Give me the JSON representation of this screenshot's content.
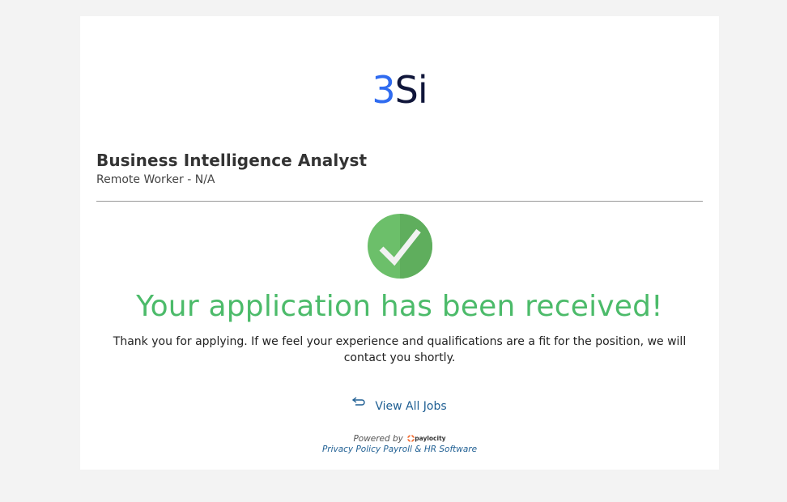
{
  "logo": {
    "part1": "3",
    "part2": "Si"
  },
  "job": {
    "title": "Business Intelligence Analyst",
    "location": "Remote Worker - N/A"
  },
  "confirmation": {
    "headline": "Your application has been received!",
    "message": "Thank you for applying. If we feel your experience and qualifications are a fit for the position, we will contact you shortly."
  },
  "nav": {
    "view_all_jobs": "View All Jobs"
  },
  "footer": {
    "powered_by": "Powered by",
    "paylocity": "paylocity",
    "privacy_policy": "Privacy Policy",
    "payroll_hr": "Payroll & HR Software"
  },
  "colors": {
    "background": "#f3f3f3",
    "headline_green": "#4cbb6a",
    "link_blue": "#1f5f93",
    "logo_blue": "#2f6bf0",
    "logo_navy": "#10163a"
  }
}
